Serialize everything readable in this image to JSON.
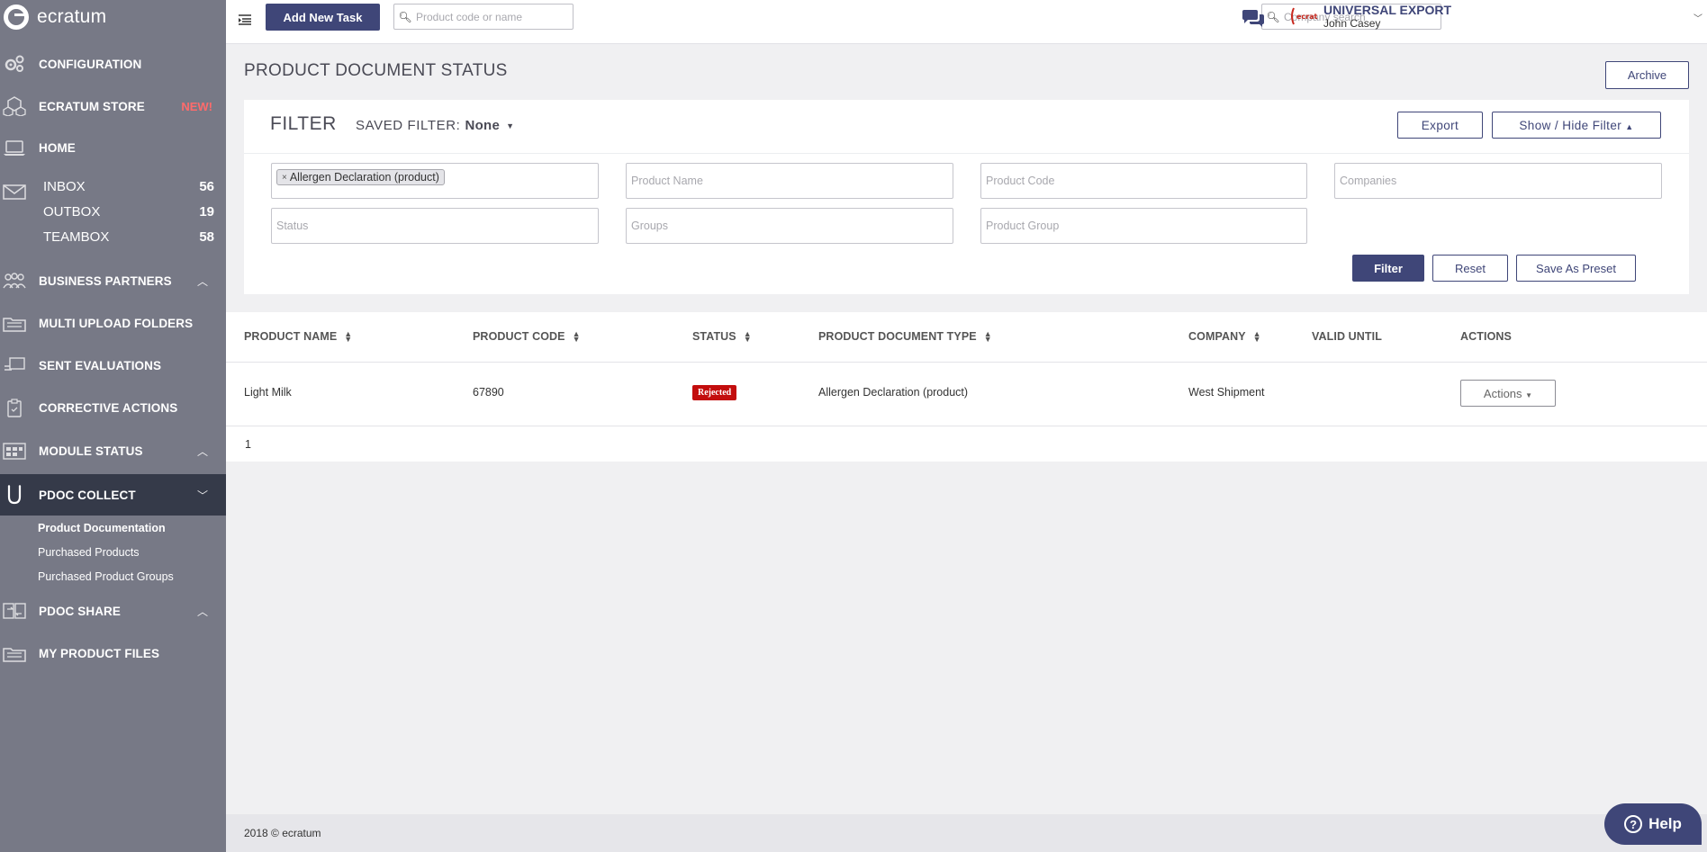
{
  "sidebar": {
    "brand": "ecratum",
    "configuration": "CONFIGURATION",
    "store": {
      "label": "ECRATUM STORE",
      "badge": "NEW!"
    },
    "home": "HOME",
    "inbox": {
      "label": "INBOX",
      "count": "56"
    },
    "outbox": {
      "label": "OUTBOX",
      "count": "19"
    },
    "teambox": {
      "label": "TEAMBOX",
      "count": "58"
    },
    "business_partners": "BUSINESS PARTNERS",
    "multi_upload": "MULTI UPLOAD FOLDERS",
    "sent_evaluations": "SENT EVALUATIONS",
    "corrective_actions": "CORRECTIVE ACTIONS",
    "module_status": "MODULE STATUS",
    "pdoc_collect": "PDOC COLLECT",
    "pdoc_collect_items": [
      "Product Documentation",
      "Purchased Products",
      "Purchased Product Groups"
    ],
    "pdoc_share": "PDOC SHARE",
    "my_product_files": "MY PRODUCT FILES"
  },
  "topbar": {
    "add_task": "Add New Task",
    "product_search_placeholder": "Product code or name",
    "company_search_placeholder": "Company search",
    "company_name": "UNIVERSAL EXPORT",
    "user_name": "John Casey",
    "brand_logo_text": "ecratum"
  },
  "page": {
    "title": "PRODUCT DOCUMENT STATUS",
    "archive": "Archive"
  },
  "filter": {
    "heading": "FILTER",
    "saved_filter_label": "SAVED FILTER:",
    "saved_filter_value": "None",
    "export": "Export",
    "show_hide": "Show / Hide Filter",
    "tag": "Allergen Declaration (product)",
    "product_name_ph": "Product Name",
    "product_code_ph": "Product Code",
    "companies_ph": "Companies",
    "status_ph": "Status",
    "groups_ph": "Groups",
    "product_group_ph": "Product Group",
    "filter_btn": "Filter",
    "reset_btn": "Reset",
    "save_preset_btn": "Save As Preset"
  },
  "table": {
    "columns": [
      "PRODUCT NAME",
      "PRODUCT CODE",
      "STATUS",
      "PRODUCT DOCUMENT TYPE",
      "COMPANY",
      "VALID UNTIL",
      "ACTIONS"
    ],
    "rows": [
      {
        "product_name": "Light Milk",
        "product_code": "67890",
        "status": "Rejected",
        "doc_type": "Allergen Declaration (product)",
        "company": "West Shipment",
        "valid_until": "",
        "actions": "Actions"
      }
    ],
    "page": "1"
  },
  "footer": {
    "copyright": "2018 © ecratum"
  },
  "help": {
    "label": "Help"
  },
  "colors": {
    "sidebar": "#777986",
    "sidebar_active": "#353a49",
    "primary": "#3f4678",
    "rejected": "#c30d0d",
    "new_badge": "#ff6b6b"
  }
}
